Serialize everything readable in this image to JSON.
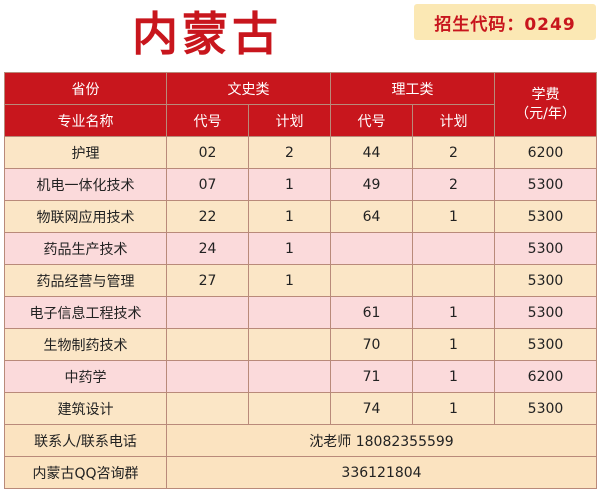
{
  "header": {
    "province": "内蒙古",
    "enrollment_code": "招生代码：0249"
  },
  "table": {
    "head": {
      "province_label": "省份",
      "major_label": "专业名称",
      "liberal_arts": "文史类",
      "science": "理工类",
      "code": "代号",
      "plan": "计划",
      "fee_line1": "学费",
      "fee_line2": "（元/年）"
    },
    "rows": [
      {
        "major": "护理",
        "wen_code": "02",
        "wen_plan": "2",
        "li_code": "44",
        "li_plan": "2",
        "fee": "6200"
      },
      {
        "major": "机电一体化技术",
        "wen_code": "07",
        "wen_plan": "1",
        "li_code": "49",
        "li_plan": "2",
        "fee": "5300"
      },
      {
        "major": "物联网应用技术",
        "wen_code": "22",
        "wen_plan": "1",
        "li_code": "64",
        "li_plan": "1",
        "fee": "5300"
      },
      {
        "major": "药品生产技术",
        "wen_code": "24",
        "wen_plan": "1",
        "li_code": "",
        "li_plan": "",
        "fee": "5300"
      },
      {
        "major": "药品经营与管理",
        "wen_code": "27",
        "wen_plan": "1",
        "li_code": "",
        "li_plan": "",
        "fee": "5300"
      },
      {
        "major": "电子信息工程技术",
        "wen_code": "",
        "wen_plan": "",
        "li_code": "61",
        "li_plan": "1",
        "fee": "5300"
      },
      {
        "major": "生物制药技术",
        "wen_code": "",
        "wen_plan": "",
        "li_code": "70",
        "li_plan": "1",
        "fee": "5300"
      },
      {
        "major": "中药学",
        "wen_code": "",
        "wen_plan": "",
        "li_code": "71",
        "li_plan": "1",
        "fee": "6200"
      },
      {
        "major": "建筑设计",
        "wen_code": "",
        "wen_plan": "",
        "li_code": "74",
        "li_plan": "1",
        "fee": "5300"
      }
    ],
    "footer": {
      "contact_label": "联系人/联系电话",
      "contact_value": "沈老师 18082355599",
      "qq_label": "内蒙古QQ咨询群",
      "qq_value": "336121804"
    }
  },
  "colors": {
    "accent_red": "#c8161d",
    "row_odd": "#fbe6c6",
    "row_even": "#fbdadb",
    "code_box_bg": "#fbe8b4"
  }
}
